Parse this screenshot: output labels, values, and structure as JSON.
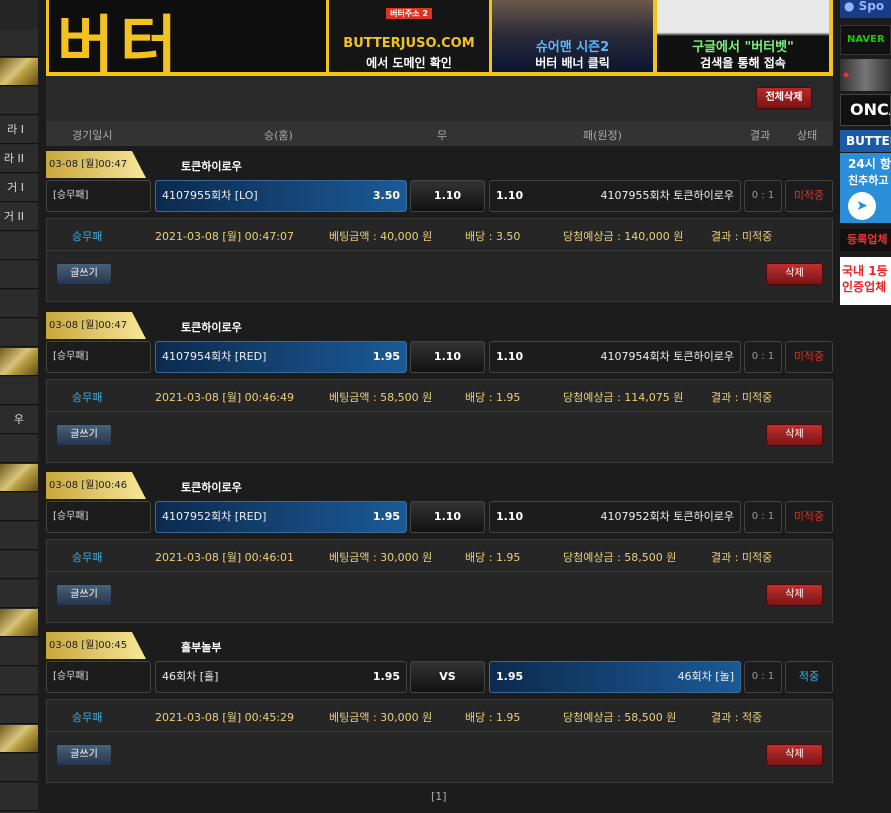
{
  "sidebar": {
    "items": [
      {
        "label": ""
      },
      {
        "label": ""
      },
      {
        "label": ""
      },
      {
        "label": "라 I"
      },
      {
        "label": "라 II"
      },
      {
        "label": "거 I"
      },
      {
        "label": "거 II"
      },
      {
        "label": ""
      },
      {
        "label": ""
      },
      {
        "label": ""
      },
      {
        "label": ""
      },
      {
        "label": ""
      },
      {
        "label": ""
      },
      {
        "label": "우"
      },
      {
        "label": ""
      },
      {
        "label": ""
      },
      {
        "label": ""
      },
      {
        "label": ""
      },
      {
        "label": ""
      },
      {
        "label": ""
      },
      {
        "label": ""
      },
      {
        "label": ""
      },
      {
        "label": ""
      },
      {
        "label": ""
      },
      {
        "label": ""
      },
      {
        "label": ""
      },
      {
        "label": ""
      }
    ]
  },
  "banner": {
    "logo_text": "버터",
    "b2_top": "버터주소 2",
    "b2_line1": "BUTTERJUSO.COM",
    "b2_line2": "에서 도메인 확인",
    "b3_line1": "슈어맨 시즌2",
    "b3_line2": "버터 배너 클릭",
    "b4_line1": "구글에서 \"버터벳\"",
    "b4_line2": "검색을 통해 접속"
  },
  "toolbar": {
    "delete_all_label": "전체삭제"
  },
  "table_header": {
    "date": "경기일시",
    "home": "승(홈)",
    "draw": "무",
    "away": "패(원정)",
    "result": "결과",
    "status": "상태"
  },
  "bets": [
    {
      "date_tag": "03-08 [월]00:47",
      "league": "토큰하이로우",
      "type": "[승무패]",
      "home_name": "4107955회차 [LO]",
      "home_odds": "3.50",
      "draw": "1.10",
      "away_odds": "1.10",
      "away_name": "4107955회차 토큰하이로우",
      "score": "0 : 1",
      "status": "미적중",
      "detail": {
        "type": "승무패",
        "datetime": "2021-03-08 [월] 00:47:07",
        "amount": "베팅금액 : 40,000 원",
        "odds": "배당 : 3.50",
        "expected": "당첨예상금 : 140,000 원",
        "result": "결과 : 미적중"
      }
    },
    {
      "date_tag": "03-08 [월]00:47",
      "league": "토큰하이로우",
      "type": "[승무패]",
      "home_name": "4107954회차 [RED]",
      "home_odds": "1.95",
      "draw": "1.10",
      "away_odds": "1.10",
      "away_name": "4107954회차 토큰하이로우",
      "score": "0 : 1",
      "status": "미적중",
      "detail": {
        "type": "승무패",
        "datetime": "2021-03-08 [월] 00:46:49",
        "amount": "베팅금액 : 58,500 원",
        "odds": "배당 : 1.95",
        "expected": "당첨예상금 : 114,075 원",
        "result": "결과 : 미적중"
      }
    },
    {
      "date_tag": "03-08 [월]00:46",
      "league": "토큰하이로우",
      "type": "[승무패]",
      "home_name": "4107952회차 [RED]",
      "home_odds": "1.95",
      "draw": "1.10",
      "away_odds": "1.10",
      "away_name": "4107952회차 토큰하이로우",
      "score": "0 : 1",
      "status": "미적중",
      "detail": {
        "type": "승무패",
        "datetime": "2021-03-08 [월] 00:46:01",
        "amount": "베팅금액 : 30,000 원",
        "odds": "배당 : 1.95",
        "expected": "당첨예상금 : 58,500 원",
        "result": "결과 : 미적중"
      }
    },
    {
      "date_tag": "03-08 [월]00:45",
      "league": "홀부놀부",
      "type": "[승무패]",
      "home_name": "46회차 [홀]",
      "home_odds": "1.95",
      "draw": "VS",
      "away_odds": "1.95",
      "away_name": "46회차 [놀]",
      "score": "0 : 1",
      "status": "적중",
      "detail": {
        "type": "승무패",
        "datetime": "2021-03-08 [월] 00:45:29",
        "amount": "베팅금액 : 30,000 원",
        "odds": "배당 : 1.95",
        "expected": "당첨예상금 : 58,500 원",
        "result": "결과 : 적중"
      }
    }
  ],
  "bet_buttons": {
    "write_label": "글쓰기",
    "delete_label": "삭제"
  },
  "pager": {
    "current": "[1]"
  },
  "right_ads": {
    "a1": "Spo",
    "a2": "NAVER",
    "a3": "ONCA",
    "a4": "BUTTER",
    "a5_line1": "24시 항",
    "a5_line2": "친추하고",
    "a6": "등록업체",
    "a7_line1": "국내 1등",
    "a7_line2": "인증업체"
  },
  "colors": {
    "miss": "#e03030",
    "hit": "#3fb0e0",
    "gold": "#f0c419"
  }
}
